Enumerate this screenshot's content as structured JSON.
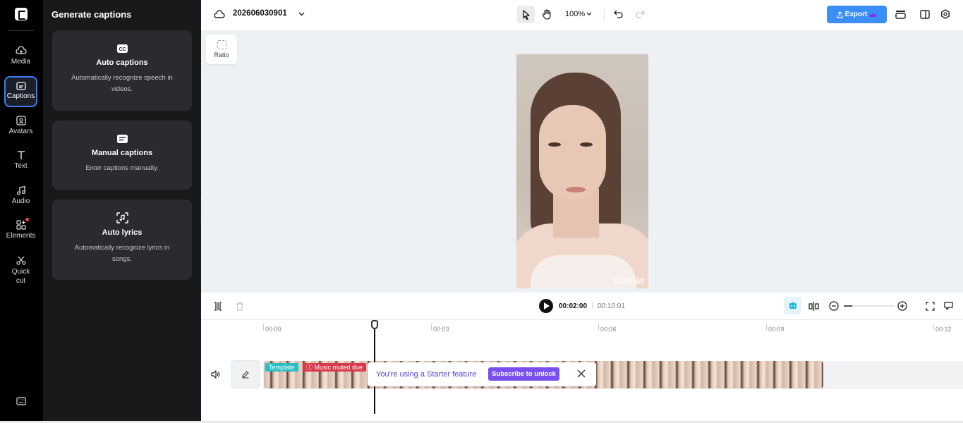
{
  "rail": {
    "items": [
      {
        "label": "Media"
      },
      {
        "label": "Captions"
      },
      {
        "label": "Avatars"
      },
      {
        "label": "Text"
      },
      {
        "label": "Audio"
      },
      {
        "label": "Elements"
      },
      {
        "label": "Quick cut"
      }
    ],
    "active": "Captions",
    "accent": "#3a7cf4"
  },
  "panel": {
    "title": "Generate captions",
    "cards": [
      {
        "title": "Auto captions",
        "desc": "Automatically recognize speech in videos.",
        "icon": "cc-icon"
      },
      {
        "title": "Manual captions",
        "desc": "Enter captions manually.",
        "icon": "keyboard-icon"
      },
      {
        "title": "Auto lyrics",
        "desc": "Automatically recognize lyrics in songs.",
        "icon": "music-scan-icon"
      }
    ]
  },
  "topbar": {
    "project_name": "202606030901",
    "zoom": "100%",
    "export_label": "Export",
    "export_color": "#3a8ef6"
  },
  "canvas": {
    "ratio_label": "Ratio",
    "watermark": "CapCut"
  },
  "timeline": {
    "current_time": "00:02:00",
    "separator": "|",
    "total_time": "00:10:01",
    "ticks": [
      "00:00",
      "00:03",
      "00:06",
      "00:09",
      "00:12"
    ],
    "clip_tags": {
      "template": "Template",
      "music": "Music muted due"
    },
    "toast": {
      "message": "You're using a Starter feature",
      "button": "Subscribe to unlock",
      "button_color": "#7a4ff0"
    }
  }
}
